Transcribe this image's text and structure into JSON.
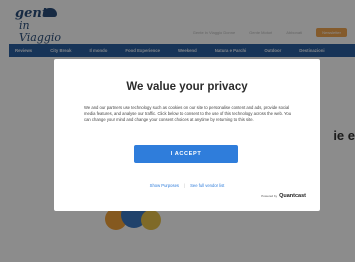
{
  "site": {
    "logo_line1": "gente",
    "logo_line2": "in Viaggio",
    "top_links": [
      "Gente in Viaggio Donne",
      "Gente Motori",
      "Abbonati"
    ],
    "top_cta": "Newsletter"
  },
  "nav": {
    "items": [
      "Reviews",
      "City Break",
      "Il mondo",
      "Food Experience",
      "Weekend",
      "Natura e Parchi",
      "Outdoor",
      "Destinazioni"
    ]
  },
  "hero": {
    "title_fragment": "ie e"
  },
  "consent": {
    "title": "We value your privacy",
    "body": "We and our partners use technology such as cookies on our site to personalise content and ads, provide social media features, and analyse our traffic. Click below to consent to the use of this technology across the web. You can change your mind and change your consent choices at anytime by returning to this site.",
    "accept_label": "I ACCEPT",
    "show_purposes": "Show Purposes",
    "separator": "|",
    "vendor_list": "See full vendor list",
    "powered_by": "Powered by",
    "brand": "Quantcast"
  },
  "colors": {
    "nav_bg": "#2b5fa0",
    "accept_bg": "#2f7ddb",
    "link": "#2f7ddb",
    "cta": "#f0a650"
  }
}
